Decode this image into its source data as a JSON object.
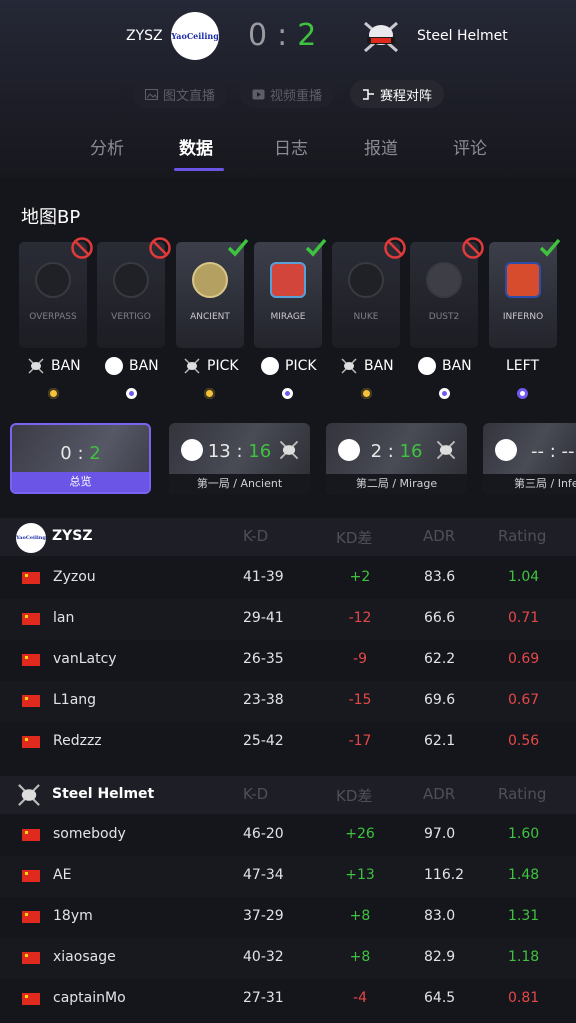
{
  "header": {
    "team_left": {
      "name": "ZYSZ",
      "logo_text": "YaoCeiling"
    },
    "team_right": {
      "name": "Steel Helmet"
    },
    "score_left": "0",
    "score_sep": ":",
    "score_right": "2",
    "pills": [
      {
        "label": "图文直播",
        "icon": "image-icon",
        "active": false
      },
      {
        "label": "视频重播",
        "icon": "play-icon",
        "active": false
      },
      {
        "label": "赛程对阵",
        "icon": "bracket-icon",
        "active": true
      }
    ]
  },
  "tabs": [
    "分析",
    "数据",
    "日志",
    "报道",
    "评论"
  ],
  "active_tab": "数据",
  "map_bp": {
    "title": "地图BP",
    "maps": [
      {
        "name": "OVERPASS",
        "status": "banned",
        "action": "BAN",
        "team": "right",
        "dot": "gold"
      },
      {
        "name": "VERTIGO",
        "status": "banned",
        "action": "BAN",
        "team": "left",
        "dot": "blue"
      },
      {
        "name": "ANCIENT",
        "status": "picked",
        "action": "PICK",
        "team": "right",
        "dot": "gold"
      },
      {
        "name": "MIRAGE",
        "status": "picked",
        "action": "PICK",
        "team": "left",
        "dot": "blue"
      },
      {
        "name": "NUKE",
        "status": "banned",
        "action": "BAN",
        "team": "right",
        "dot": "gold"
      },
      {
        "name": "DUST2",
        "status": "banned",
        "action": "BAN",
        "team": "left",
        "dot": "blue"
      },
      {
        "name": "INFERNO",
        "status": "picked",
        "action": "LEFT",
        "team": "none",
        "dot": "white"
      }
    ]
  },
  "games": [
    {
      "label": "总览",
      "score_l": "0",
      "score_r": "2",
      "winner": "right",
      "active": true
    },
    {
      "label": "第一局 / Ancient",
      "score_l": "13",
      "score_r": "16",
      "winner": "right",
      "active": false
    },
    {
      "label": "第二局 / Mirage",
      "score_l": "2",
      "score_r": "16",
      "winner": "right",
      "active": false
    },
    {
      "label": "第三局 / Inferno",
      "score_l": "--",
      "score_r": "--",
      "winner": "none",
      "active": false
    }
  ],
  "columns": [
    "K-D",
    "KD差",
    "ADR",
    "Rating"
  ],
  "team_left_stats": {
    "name": "ZYSZ",
    "players": [
      {
        "name": "Zyzou",
        "kd": "41-39",
        "diff": "+2",
        "adr": "83.6",
        "rating": "1.04"
      },
      {
        "name": "lan",
        "kd": "29-41",
        "diff": "-12",
        "adr": "66.6",
        "rating": "0.71"
      },
      {
        "name": "vanLatcy",
        "kd": "26-35",
        "diff": "-9",
        "adr": "62.2",
        "rating": "0.69"
      },
      {
        "name": "L1ang",
        "kd": "23-38",
        "diff": "-15",
        "adr": "69.6",
        "rating": "0.67"
      },
      {
        "name": "Redzzz",
        "kd": "25-42",
        "diff": "-17",
        "adr": "62.1",
        "rating": "0.56"
      }
    ]
  },
  "team_right_stats": {
    "name": "Steel Helmet",
    "players": [
      {
        "name": "somebody",
        "kd": "46-20",
        "diff": "+26",
        "adr": "97.0",
        "rating": "1.60"
      },
      {
        "name": "AE",
        "kd": "47-34",
        "diff": "+13",
        "adr": "116.2",
        "rating": "1.48"
      },
      {
        "name": "18ym",
        "kd": "37-29",
        "diff": "+8",
        "adr": "83.0",
        "rating": "1.31"
      },
      {
        "name": "xiaosage",
        "kd": "40-32",
        "diff": "+8",
        "adr": "82.9",
        "rating": "1.18"
      },
      {
        "name": "captainMo",
        "kd": "27-31",
        "diff": "-4",
        "adr": "64.5",
        "rating": "0.81"
      }
    ]
  },
  "colors": {
    "accent": "#6a55e6",
    "positive": "#3fc23f",
    "negative": "#e54848",
    "gold": "#f6c23a"
  }
}
